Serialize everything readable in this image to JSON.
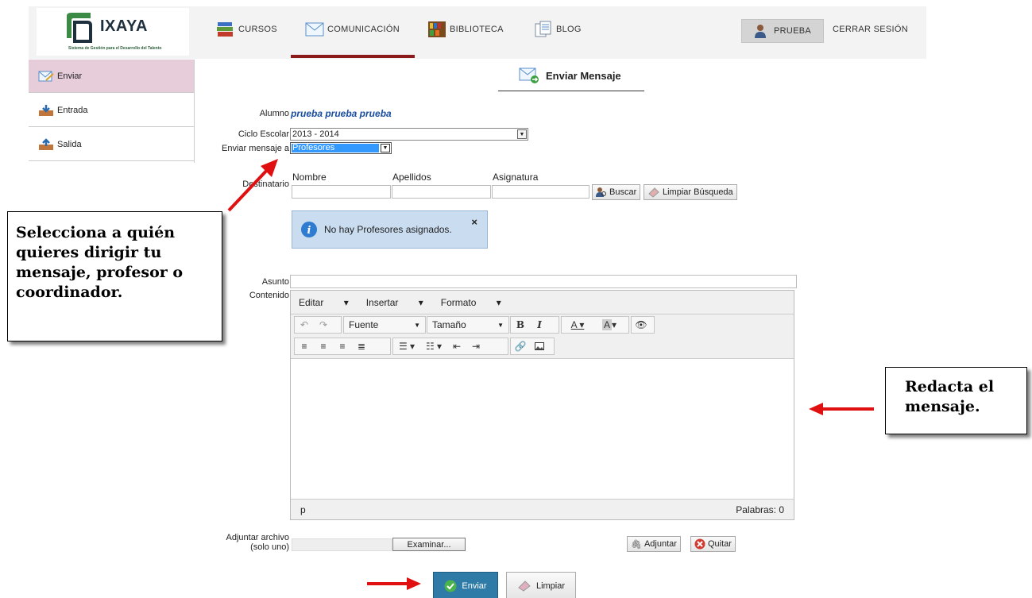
{
  "logo": {
    "title": "IXAYA",
    "subtitle": "Sistema de Gestión para el Desarrollo del Talento"
  },
  "nav": {
    "cursos": "CURSOS",
    "comunicacion": "COMUNICACIÓN",
    "biblioteca": "BIBLIOTECA",
    "blog": "BLOG",
    "user": "PRUEBA",
    "logout": "CERRAR SESIÓN"
  },
  "sidebar": {
    "items": [
      {
        "label": "Enviar"
      },
      {
        "label": "Entrada"
      },
      {
        "label": "Salida"
      }
    ]
  },
  "page": {
    "title": "Enviar Mensaje"
  },
  "form": {
    "alumno_label": "Alumno",
    "alumno_value": "prueba prueba prueba",
    "ciclo_label": "Ciclo Escolar",
    "ciclo_value": "2013 - 2014",
    "enviar_a_label": "Enviar mensaje a",
    "enviar_a_value": "Profesores",
    "destinatario_label": "Destinatario",
    "col_nombre": "Nombre",
    "col_apellidos": "Apellidos",
    "col_asignatura": "Asignatura",
    "buscar": "Buscar",
    "limpiar_busqueda": "Limpiar Búsqueda",
    "info_message": "No hay Profesores asignados.",
    "asunto_label": "Asunto",
    "contenido_label": "Contenido",
    "adjuntar_label": "Adjuntar archivo",
    "adjuntar_sub": "(solo uno)",
    "examinar": "Examinar...",
    "adjuntar_btn": "Adjuntar",
    "quitar_btn": "Quitar",
    "enviar_btn": "Enviar",
    "limpiar_btn": "Limpiar"
  },
  "editor": {
    "menus": [
      "Editar",
      "Insertar",
      "Formato"
    ],
    "font_label": "Fuente",
    "size_label": "Tamaño",
    "status_path": "p",
    "word_count": "Palabras: 0"
  },
  "callouts": {
    "left": "Selecciona a quién quieres dirigir tu mensaje, profesor o coordinador.",
    "right": "Redacta el mensaje."
  },
  "colors": {
    "nav_underline": "#8b1a1a",
    "sidebar_active": "#e7ccd9",
    "send_button": "#2f7ba8",
    "arrow": "#e01010",
    "info_bg": "#c9dcf0"
  }
}
